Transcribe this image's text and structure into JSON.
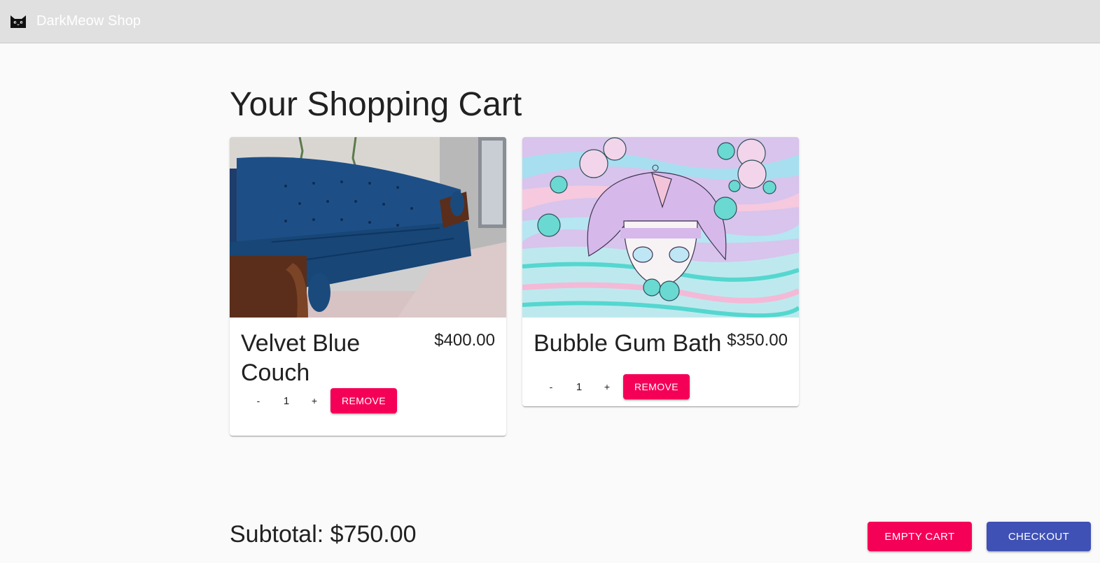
{
  "app": {
    "title": "DarkMeow Shop",
    "logo_icon": "cat-icon"
  },
  "page": {
    "title": "Your Shopping Cart"
  },
  "cart": {
    "items": [
      {
        "name": "Velvet Blue Couch",
        "price": "$400.00",
        "quantity": "1",
        "decrement_label": "-",
        "increment_label": "+",
        "remove_label": "REMOVE",
        "image": "couch-photo"
      },
      {
        "name": "Bubble Gum Bath",
        "price": "$350.00",
        "quantity": "1",
        "decrement_label": "-",
        "increment_label": "+",
        "remove_label": "REMOVE",
        "image": "bubble-girl-illustration"
      }
    ],
    "subtotal": "Subtotal: $750.00",
    "empty_label": "EMPTY CART",
    "checkout_label": "CHECKOUT"
  },
  "colors": {
    "appbar": "#e0e0e0",
    "secondary": "#f50057",
    "primary": "#3f51b5",
    "background": "#fafafa"
  }
}
